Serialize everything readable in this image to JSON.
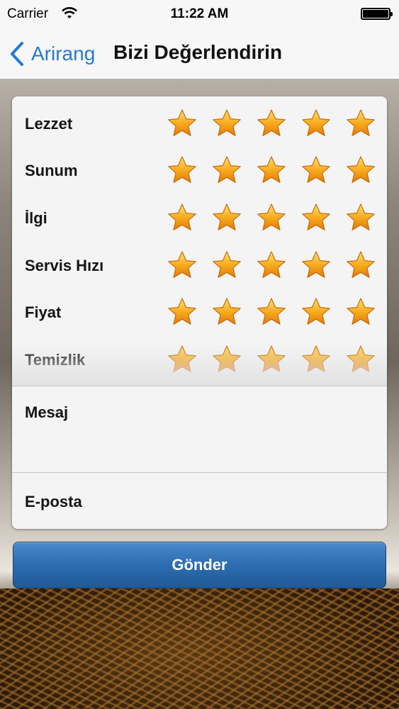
{
  "status_bar": {
    "carrier": "Carrier",
    "time": "11:22 AM",
    "wifi_icon": "wifi-icon",
    "battery_icon": "battery-icon",
    "battery_level": 1.0
  },
  "nav": {
    "back_label": "Arirang",
    "back_icon": "chevron-left-icon",
    "title": "Bizi Değerlendirin",
    "accent_color": "#2479d6"
  },
  "ratings": [
    {
      "label": "Lezzet",
      "stars": 5
    },
    {
      "label": "Sunum",
      "stars": 5
    },
    {
      "label": "İlgi",
      "stars": 5
    },
    {
      "label": "Servis Hızı",
      "stars": 5
    },
    {
      "label": "Fiyat",
      "stars": 5
    },
    {
      "label": "Temizlik",
      "stars": 5
    }
  ],
  "form": {
    "message_label": "Mesaj",
    "message_value": "",
    "email_label": "E-posta",
    "email_value": ""
  },
  "submit": {
    "label": "Gönder",
    "color": "#2f6fb2"
  },
  "star_color": "#f7a81b"
}
